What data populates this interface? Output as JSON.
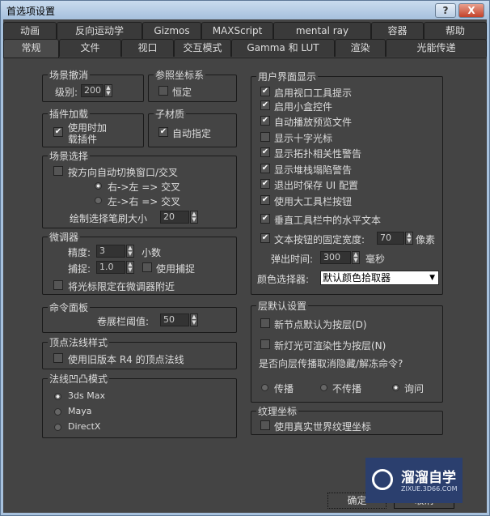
{
  "window": {
    "title": "首选项设置",
    "help": "?",
    "close": "X"
  },
  "tabs_row1": [
    "动画",
    "反向运动学",
    "Gizmos",
    "MAXScript",
    "mental ray",
    "容器",
    "帮助"
  ],
  "tabs_row2": [
    "常规",
    "文件",
    "视口",
    "交互模式",
    "Gamma 和 LUT",
    "渲染",
    "光能传递"
  ],
  "scene_undo": {
    "title": "场景撤消",
    "label": "级别:",
    "value": "200"
  },
  "ref_coord": {
    "title": "参照坐标系",
    "constant": "恒定"
  },
  "plugin": {
    "title": "插件加载",
    "line1": "使用时加",
    "line2": "载插件"
  },
  "submat": {
    "title": "子材质",
    "auto": "自动指定"
  },
  "scene_sel": {
    "title": "场景选择",
    "auto_switch": "按方向自动切换窗口/交叉",
    "r2l": "右->左 => 交叉",
    "l2r": "左->右 => 交叉",
    "brush_label": "绘制选择笔刷大小",
    "brush_value": "20"
  },
  "spinner": {
    "title": "微调器",
    "precision_label": "精度:",
    "precision_value": "3",
    "decimals": "小数",
    "snap_label": "捕捉:",
    "snap_value": "1.0",
    "use_snap": "使用捕捉",
    "wrap": "将光标限定在微调器附近"
  },
  "cmd_panel": {
    "title": "命令面板",
    "label": "卷展栏阈值:",
    "value": "50"
  },
  "vertex_normal": {
    "title": "顶点法线样式",
    "legacy": "使用旧版本 R4 的顶点法线"
  },
  "bump": {
    "title": "法线凹凸模式",
    "options": [
      "3ds Max",
      "Maya",
      "DirectX"
    ]
  },
  "ui_display": {
    "title": "用户界面显示",
    "items": [
      "启用视口工具提示",
      "启用小盒控件",
      "自动播放预览文件",
      "显示十字光标",
      "显示拓扑相关性警告",
      "显示堆栈塌陷警告",
      "退出时保存 UI 配置",
      "使用大工具栏按钮",
      "垂直工具栏中的水平文本",
      "文本按钮的固定宽度:"
    ],
    "width_value": "70",
    "width_unit": "像素",
    "flyout_label": "弹出时间:",
    "flyout_value": "300",
    "flyout_unit": "毫秒",
    "color_label": "颜色选择器:",
    "color_value": "默认颜色拾取器"
  },
  "layer": {
    "title": "层默认设置",
    "new_nodes": "新节点默认为按层(D)",
    "new_lights": "新灯光可渲染性为按层(N)",
    "question": "是否向层传播取消隐藏/解冻命令?",
    "options": [
      "传播",
      "不传播",
      "询问"
    ]
  },
  "texture": {
    "title": "纹理坐标",
    "real_world": "使用真实世界纹理坐标"
  },
  "buttons": {
    "ok": "确定",
    "cancel": "取消"
  },
  "watermark": {
    "name": "溜溜自学",
    "url": "ZIXUE.3D66.COM"
  }
}
